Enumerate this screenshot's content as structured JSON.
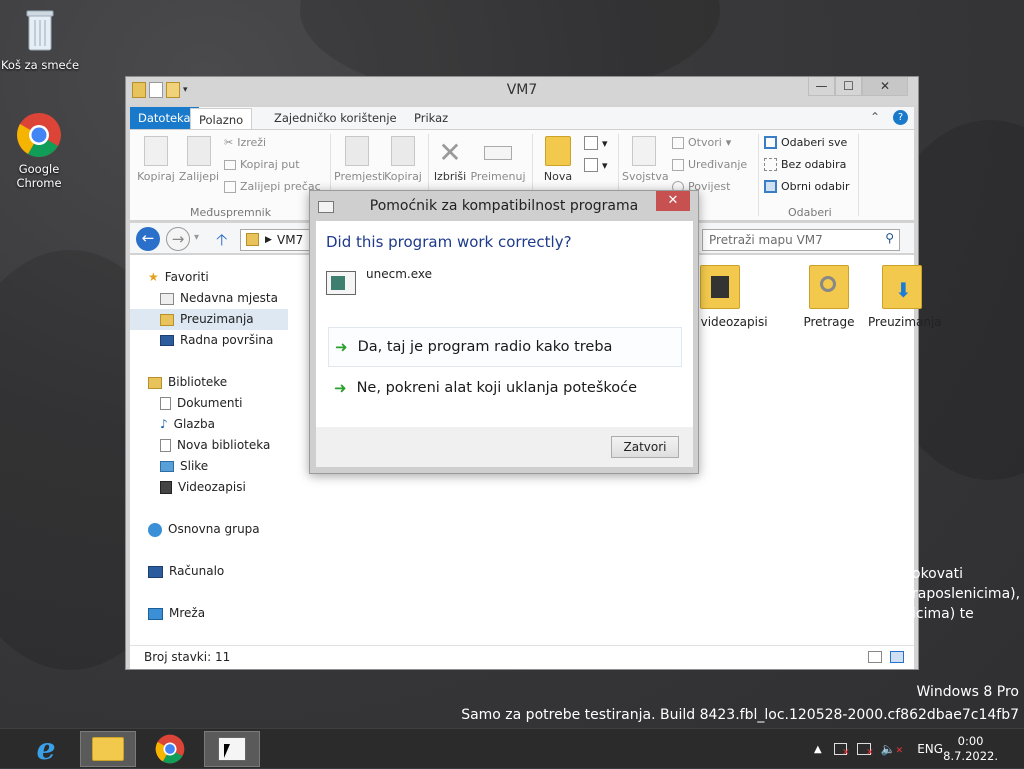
{
  "desktop": {
    "icons": [
      {
        "label": "Koš za smeće"
      },
      {
        "label": "Google Chrome"
      }
    ],
    "overflow_lines": [
      "okovati",
      "raposlenicima),",
      "icima) te"
    ],
    "watermark": {
      "line1": "Windows 8 Pro",
      "line2": "Samo za potrebe testiranja. Build 8423.fbl_loc.120528-2000.cf862dbae7c14fb7"
    }
  },
  "explorer": {
    "title": "VM7",
    "window_buttons": {
      "minimize": "—",
      "maximize": "☐",
      "close": "✕"
    },
    "tabs": [
      "Datoteka",
      "Polazno",
      "Zajedničko korištenje",
      "Prikaz"
    ],
    "ribbon": {
      "clipboard": {
        "copy": "Kopiraj",
        "paste": "Zalijepi",
        "cut": "Izreži",
        "copy_path": "Kopiraj put",
        "paste_shortcut": "Zalijepi prečac",
        "group": "Međuspremnik"
      },
      "organize": {
        "move": "Premjesti",
        "copy": "Kopiraj",
        "delete": "Izbriši",
        "rename": "Preimenuj"
      },
      "new": {
        "new_folder": "Nova"
      },
      "open": {
        "properties": "Svojstva",
        "open": "Otvori",
        "edit": "Uređivanje",
        "history": "Povijest"
      },
      "select": {
        "select_all": "Odaberi sve",
        "select_none": "Bez odabira",
        "invert": "Obrni odabir",
        "group": "Odaberi"
      }
    },
    "address": "VM7",
    "search_placeholder": "Pretraži mapu VM7",
    "nav": {
      "favorites": "Favoriti",
      "recent": "Nedavna mjesta",
      "downloads": "Preuzimanja",
      "desktop": "Radna površina",
      "libraries": "Biblioteke",
      "documents": "Dokumenti",
      "music": "Glazba",
      "new_library": "Nova biblioteka",
      "pictures": "Slike",
      "videos": "Videozapisi",
      "homegroup": "Osnovna grupa",
      "computer": "Računalo",
      "network": "Mreža"
    },
    "folders": [
      {
        "label": "Moji videozapisi"
      },
      {
        "label": "Pretrage"
      },
      {
        "label": "Preuzimanja"
      }
    ],
    "status": "Broj stavki: 11"
  },
  "dialog": {
    "title": "Pomoćnik za kompatibilnost programa",
    "close": "✕",
    "question": "Did this program work correctly?",
    "file": "unecm.exe",
    "option_yes": "Da, taj je program radio kako treba",
    "option_no": "Ne, pokreni alat koji uklanja poteškoće",
    "button_close": "Zatvori"
  },
  "taskbar": {
    "language": "ENG",
    "time": "0:00",
    "date": "8.7.2022."
  },
  "colors": {
    "accent": "#1979ca",
    "dialog_close": "#c75050",
    "question_text": "#1e3a8a"
  }
}
